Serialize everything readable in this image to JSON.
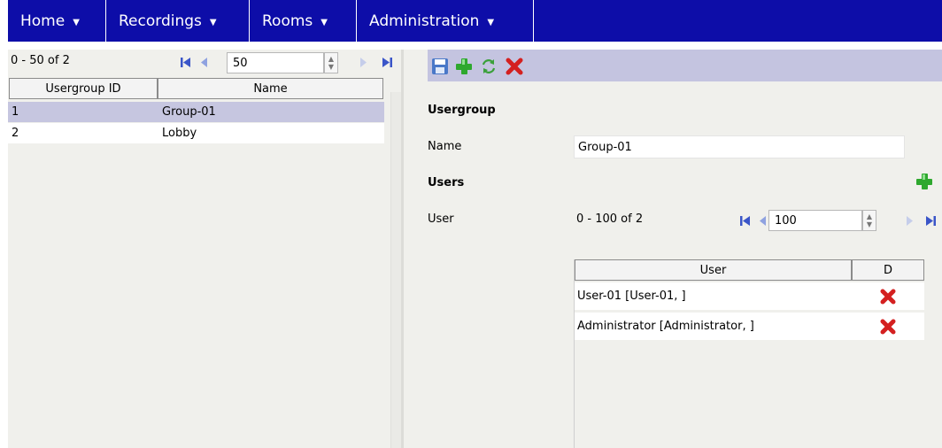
{
  "menu": [
    {
      "label": "Home"
    },
    {
      "label": "Recordings"
    },
    {
      "label": "Rooms"
    },
    {
      "label": "Administration"
    }
  ],
  "left": {
    "pager": {
      "summary": "0 - 50 of 2",
      "page_size": "50"
    },
    "columns": [
      "Usergroup ID",
      "Name"
    ],
    "rows": [
      {
        "id": "1",
        "name": "Group-01",
        "selected": true
      },
      {
        "id": "2",
        "name": "Lobby",
        "selected": false
      }
    ]
  },
  "right": {
    "section_usergroup": "Usergroup",
    "name_label": "Name",
    "name_value": "Group-01",
    "section_users": "Users",
    "user_label": "User",
    "pager": {
      "summary": "0 - 100 of 2",
      "page_size": "100"
    },
    "columns": [
      "User",
      "D"
    ],
    "rows": [
      {
        "user": "User-01 [User-01, ]"
      },
      {
        "user": "Administrator [Administrator, ]"
      }
    ]
  },
  "colors": {
    "menubar": "#0d0da8",
    "toolbar": "#c4c4e0",
    "selected_row": "#c6c6e0",
    "panel": "#f0f0ec"
  },
  "icons": [
    "save-icon",
    "add-icon",
    "refresh-icon",
    "delete-icon",
    "first-page-icon",
    "prev-page-icon",
    "next-page-icon",
    "last-page-icon"
  ]
}
